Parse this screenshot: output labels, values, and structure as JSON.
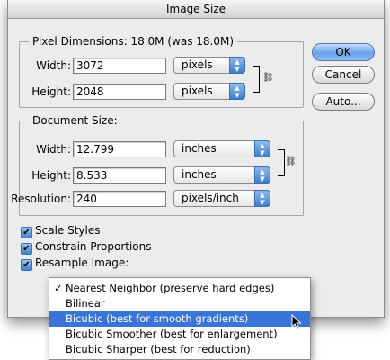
{
  "dialog": {
    "title": "Image Size"
  },
  "pixel_dimensions": {
    "label": "Pixel Dimensions:  18.0M (was 18.0M)",
    "width_label": "Width:",
    "width_value": "3072",
    "width_unit": "pixels",
    "height_label": "Height:",
    "height_value": "2048",
    "height_unit": "pixels"
  },
  "buttons": {
    "ok": "OK",
    "cancel": "Cancel",
    "auto": "Auto..."
  },
  "document_size": {
    "label": "Document Size:",
    "width_label": "Width:",
    "width_value": "12.799",
    "width_unit": "inches",
    "height_label": "Height:",
    "height_value": "8.533",
    "height_unit": "inches",
    "resolution_label": "Resolution:",
    "resolution_value": "240",
    "resolution_unit": "pixels/inch"
  },
  "checkboxes": {
    "scale_styles": {
      "label": "Scale Styles",
      "checked": true
    },
    "constrain_proportions": {
      "label": "Constrain Proportions",
      "checked": true
    },
    "resample_image": {
      "label": "Resample Image:",
      "checked": true
    }
  },
  "resample_menu": {
    "items": [
      {
        "label": "Nearest Neighbor (preserve hard edges)",
        "checked": true,
        "highlighted": false
      },
      {
        "label": "Bilinear",
        "checked": false,
        "highlighted": false
      },
      {
        "label": "Bicubic (best for smooth gradients)",
        "checked": false,
        "highlighted": true
      },
      {
        "label": "Bicubic Smoother (best for enlargement)",
        "checked": false,
        "highlighted": false
      },
      {
        "label": "Bicubic Sharper (best for reduction)",
        "checked": false,
        "highlighted": false
      }
    ]
  },
  "colors": {
    "highlight": "#3875d7",
    "dialog_bg": "#ececec",
    "default_button": "#6aa3ea"
  }
}
